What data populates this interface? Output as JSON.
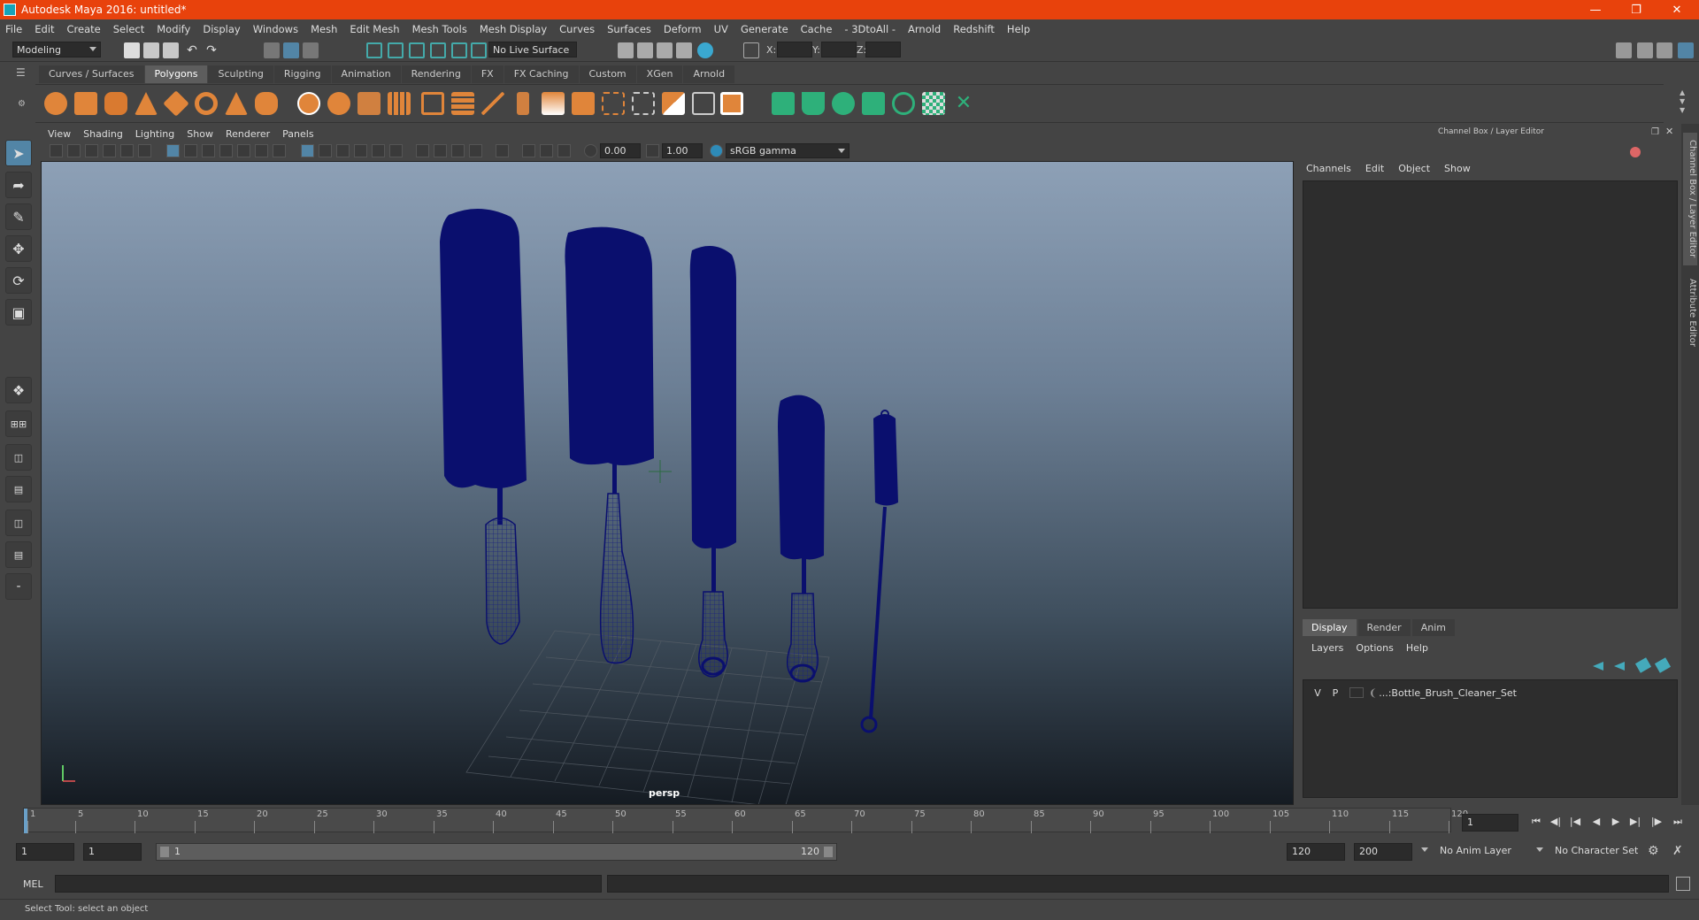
{
  "window": {
    "title": "Autodesk Maya 2016: untitled*"
  },
  "menubar": {
    "items": [
      "File",
      "Edit",
      "Create",
      "Select",
      "Modify",
      "Display",
      "Windows",
      "Mesh",
      "Edit Mesh",
      "Mesh Tools",
      "Mesh Display",
      "Curves",
      "Surfaces",
      "Deform",
      "UV",
      "Generate",
      "Cache",
      "- 3DtoAll -",
      "Arnold",
      "Redshift",
      "Help"
    ]
  },
  "statusline": {
    "mode": "Modeling",
    "live_surface": "No Live Surface",
    "x_label": "X:",
    "y_label": "Y:",
    "z_label": "Z:"
  },
  "shelf": {
    "tabs": [
      "Curves / Surfaces",
      "Polygons",
      "Sculpting",
      "Rigging",
      "Animation",
      "Rendering",
      "FX",
      "FX Caching",
      "Custom",
      "XGen",
      "Arnold"
    ],
    "active_tab": "Polygons"
  },
  "panel": {
    "menus": [
      "View",
      "Shading",
      "Lighting",
      "Show",
      "Renderer",
      "Panels"
    ],
    "exposure": "0.00",
    "gamma": "1.00",
    "color_space": "sRGB gamma",
    "camera_label": "persp"
  },
  "channel_box": {
    "header": "Channel Box / Layer Editor",
    "menus": [
      "Channels",
      "Edit",
      "Object",
      "Show"
    ],
    "side_tab_1": "Channel Box / Layer Editor",
    "side_tab_2": "Attribute Editor"
  },
  "layer_editor": {
    "tabs": [
      "Display",
      "Render",
      "Anim"
    ],
    "active_tab": "Display",
    "menus": [
      "Layers",
      "Options",
      "Help"
    ],
    "layers": [
      {
        "v": "V",
        "p": "P",
        "name": "...:Bottle_Brush_Cleaner_Set"
      }
    ]
  },
  "timeline": {
    "ticks": [
      "1",
      "5",
      "10",
      "15",
      "20",
      "25",
      "30",
      "35",
      "40",
      "45",
      "50",
      "55",
      "60",
      "65",
      "70",
      "75",
      "80",
      "85",
      "90",
      "95",
      "100",
      "105",
      "110",
      "115",
      "120"
    ],
    "current_frame": "1"
  },
  "range": {
    "start": "1",
    "playback_start": "1",
    "slider_start": "1",
    "slider_end": "120",
    "playback_end": "120",
    "end": "200",
    "anim_layer": "No Anim Layer",
    "character_set": "No Character Set"
  },
  "command": {
    "label": "MEL"
  },
  "help": {
    "text": "Select Tool: select an object"
  },
  "colors": {
    "title_bar": "#e8420c",
    "mesh": "#0a0f6e",
    "accent": "#5285a6"
  }
}
